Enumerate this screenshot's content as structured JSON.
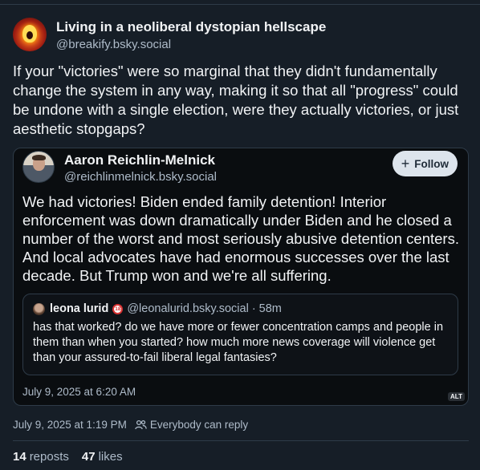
{
  "author": {
    "name": "Living in a neoliberal dystopian hellscape",
    "handle": "@breakify.bsky.social"
  },
  "post": {
    "text": "If your \"victories\" were so marginal that they didn't fundamentally change the system in any way, making it so that all \"progress\" could be undone with a single election, were they actually victories, or just aesthetic stopgaps?",
    "timestamp": "July 9, 2025 at 1:19 PM",
    "reply_setting": "Everybody can reply",
    "reposts_count": "14",
    "reposts_label": "reposts",
    "likes_count": "47",
    "likes_label": "likes"
  },
  "quoted_post": {
    "author_name": "Aaron Reichlin-Melnick",
    "author_handle": "@reichlinmelnick.bsky.social",
    "follow_label": "Follow",
    "text": "We had victories! Biden ended family detention! Interior enforcement was down dramatically under Biden and he closed a number of the worst and most seriously abusive detention centers. And local advocates have had enormous successes over the last decade. But Trump won and we're all suffering.",
    "date": "July 9, 2025 at 6:20 AM",
    "alt_badge": "ALT",
    "nested_quote": {
      "author_name": "leona lurid",
      "badge": "18",
      "meta": "@leonalurid.bsky.social · 58m",
      "text": "has that worked? do we have more or fewer concentration camps and people in them than when you started? how much more news coverage will violence get than your assured-to-fail liberal legal fantasies?"
    }
  },
  "icons": {
    "follow": "plus-icon",
    "reply_setting": "people-icon"
  },
  "colors": {
    "background": "#161e27",
    "embed_background": "#0a0d10",
    "border": "#2e3b48",
    "text_primary": "#f1f3f5",
    "text_secondary": "#aebbc9",
    "follow_button_bg": "#dde4ec"
  }
}
